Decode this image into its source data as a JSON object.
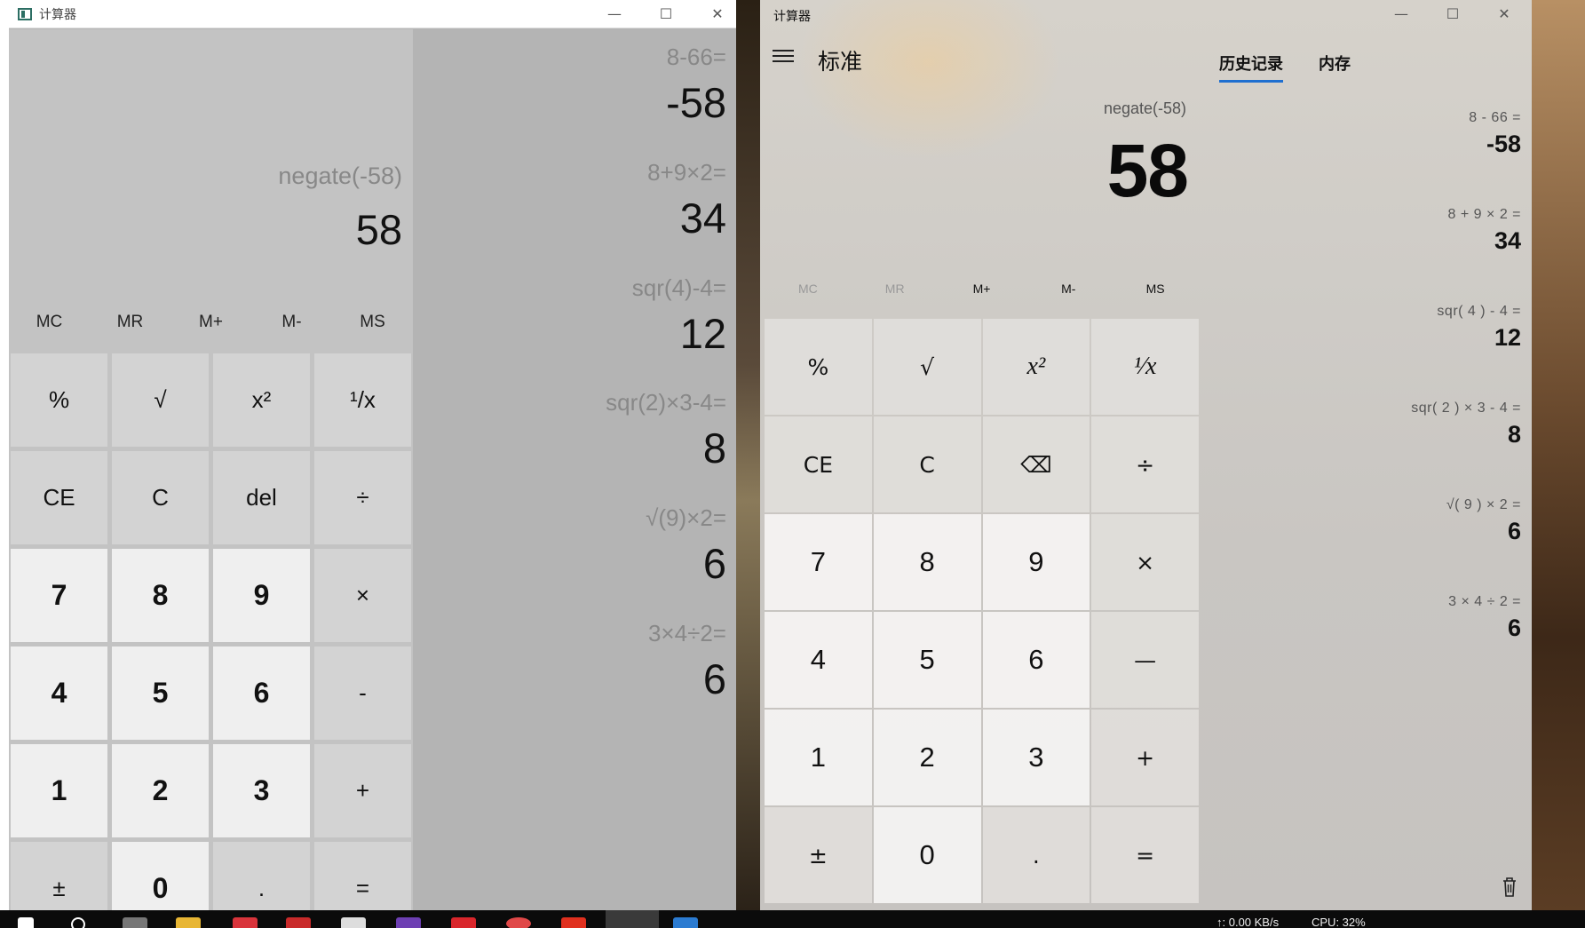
{
  "left_window": {
    "title": "计算器",
    "controls": {
      "minimize": "—",
      "maximize": "☐",
      "close": "✕"
    },
    "expression": "negate(-58)",
    "result": "58",
    "memory": [
      "MC",
      "MR",
      "M+",
      "M-",
      "MS"
    ],
    "keys": [
      "%",
      "√",
      "x²",
      "¹/x",
      "CE",
      "C",
      "del",
      "÷",
      "7",
      "8",
      "9",
      "×",
      "4",
      "5",
      "6",
      "-",
      "1",
      "2",
      "3",
      "+",
      "±",
      "0",
      ".",
      "="
    ],
    "history": [
      {
        "expr": "8-66=",
        "value": "-58"
      },
      {
        "expr": "8+9×2=",
        "value": "34"
      },
      {
        "expr": "sqr(4)-4=",
        "value": "12"
      },
      {
        "expr": "sqr(2)×3-4=",
        "value": "8"
      },
      {
        "expr": "√(9)×2=",
        "value": "6"
      },
      {
        "expr": "3×4÷2=",
        "value": "6"
      }
    ]
  },
  "right_window": {
    "title": "计算器",
    "controls": {
      "minimize": "—",
      "maximize": "☐",
      "close": "✕"
    },
    "mode": "标准",
    "expression": "negate(-58)",
    "result": "58",
    "memory": [
      "MC",
      "MR",
      "M+",
      "M-",
      "MS"
    ],
    "keys": [
      "%",
      "√",
      "x²",
      "¹⁄x",
      "CE",
      "C",
      "⌫",
      "÷",
      "7",
      "8",
      "9",
      "×",
      "4",
      "5",
      "6",
      "—",
      "1",
      "2",
      "3",
      "+",
      "±",
      "0",
      ".",
      "="
    ],
    "tabs": [
      "历史记录",
      "内存"
    ],
    "history": [
      {
        "expr": "8  -  66 =",
        "value": "-58"
      },
      {
        "expr": "8  +  9  ×  2 =",
        "value": "34"
      },
      {
        "expr": "sqr( 4 )  -  4 =",
        "value": "12"
      },
      {
        "expr": "sqr( 2 )  ×  3  -  4 =",
        "value": "8"
      },
      {
        "expr": "√( 9 )  ×  2 =",
        "value": "6"
      },
      {
        "expr": "3  ×  4  ÷  2 =",
        "value": "6"
      }
    ]
  },
  "taskbar": {
    "net_speed": "↑: 0.00 KB/s",
    "cpu": "CPU: 32%"
  }
}
